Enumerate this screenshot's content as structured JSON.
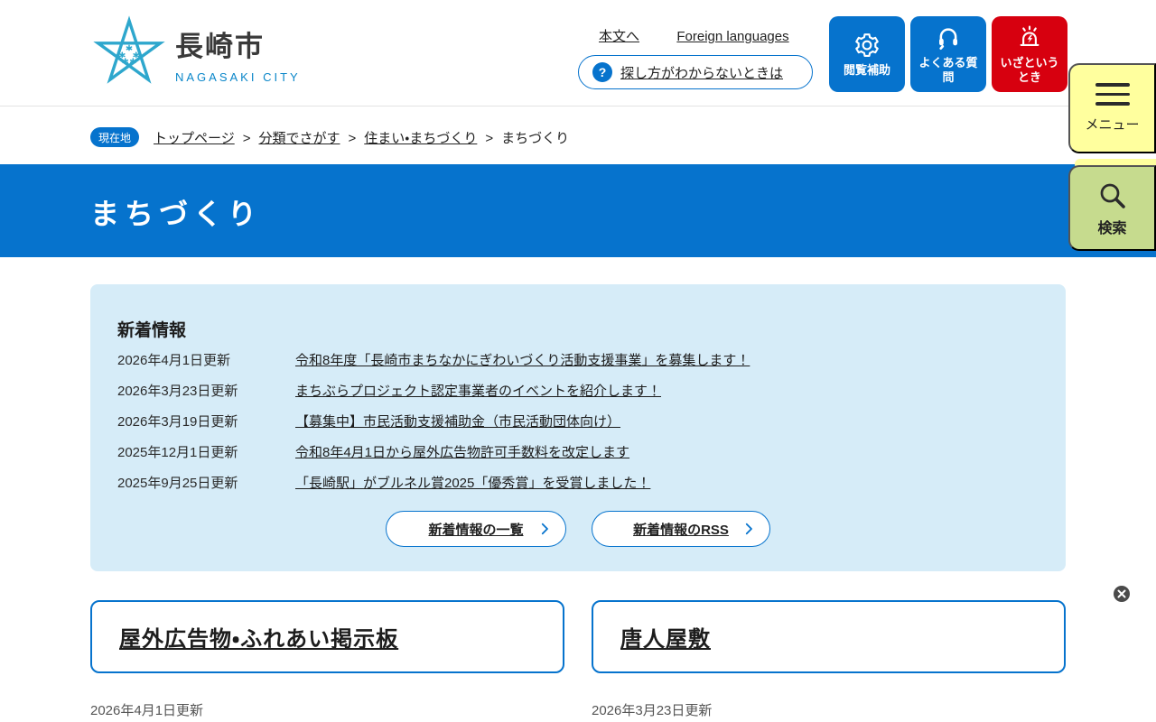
{
  "colors": {
    "primary_blue": "#0673cd",
    "emergency_red": "#d7000f",
    "menu_yellow": "#ffff9e",
    "search_green": "#c6db8e",
    "news_panel_blue": "#d6ecf8",
    "logo_cyan": "#2ea7cd"
  },
  "icons": {
    "logo": "star-icon",
    "help": "question-icon",
    "browse_aid": "gear-icon",
    "faq": "headset-icon",
    "emergency": "siren-icon",
    "menu": "hamburger-icon",
    "search": "magnifier-icon",
    "list_buttons": "chevron-right-icon",
    "floating": "close-icon"
  },
  "header": {
    "logo": {
      "city_name": "長崎市",
      "city_name_en": "NAGASAKI CITY"
    },
    "links": {
      "skip_to_content": "本文へ",
      "foreign_languages": "Foreign languages"
    },
    "help_button": {
      "icon_glyph": "?",
      "label": "探し方がわからないときは"
    },
    "quick_buttons": [
      {
        "label": "閲覧補助"
      },
      {
        "label": "よくある質問"
      },
      {
        "label": "いざというとき"
      }
    ],
    "menu_button": {
      "label": "メニュー"
    },
    "search_button": {
      "label": "検索"
    }
  },
  "breadcrumb": {
    "badge": "現在地",
    "separator": ">",
    "items": [
      {
        "label": "トップページ"
      },
      {
        "label": "分類でさがす"
      },
      {
        "label": "住まい・まちづくり"
      },
      {
        "label": "まちづくり"
      }
    ]
  },
  "page": {
    "title": "まちづくり"
  },
  "news": {
    "title": "新着情報",
    "items": [
      {
        "date": "2026年4月1日更新",
        "title": "令和8年度「長崎市まちなかにぎわいづくり活動支援事業」を募集します！"
      },
      {
        "date": "2026年3月23日更新",
        "title": "まちぶらプロジェクト認定事業者のイベントを紹介します！"
      },
      {
        "date": "2026年3月19日更新",
        "title": "【募集中】市民活動支援補助金（市民活動団体向け）"
      },
      {
        "date": "2025年12月1日更新",
        "title": "令和8年4月1日から屋外広告物許可手数料を改定します"
      },
      {
        "date": "2025年9月25日更新",
        "title": "「長崎駅」がブルネル賞2025「優秀賞」を受賞しました！"
      }
    ],
    "buttons": [
      {
        "label": "新着情報の一覧"
      },
      {
        "label": "新着情報のRSS"
      }
    ]
  },
  "cards": [
    {
      "title": "屋外広告物・ふれあい掲示板",
      "date": "2026年4月1日更新"
    },
    {
      "title": "唐人屋敷",
      "date": "2026年3月23日更新"
    }
  ]
}
